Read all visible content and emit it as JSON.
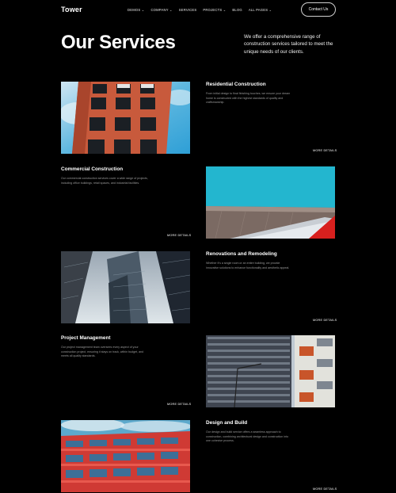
{
  "nav": {
    "logo": "Tower",
    "items": [
      {
        "label": "DEMOS ⌄"
      },
      {
        "label": "COMPANY ⌄"
      },
      {
        "label": "SERVICES"
      },
      {
        "label": "PROJECTS ⌄"
      },
      {
        "label": "BLOG"
      },
      {
        "label": "ALL PAGES ⌄"
      }
    ],
    "contact_label": "Contact Us"
  },
  "hero": {
    "title": "Our Services",
    "description": "We offer a comprehensive range of construction services tailored to meet the unique needs of our clients."
  },
  "services": [
    {
      "title": "Residential Construction",
      "description": "From initial design to final finishing touches, we ensure your dream home is constructed with the highest standards of quality and craftsmanship.",
      "more": "MORE DETAILS"
    },
    {
      "title": "Commercial Construction",
      "description": "Our commercial construction services cover a wide range of projects, including office buildings, retail spaces, and industrial facilities.",
      "more": "MORE DETAILS"
    },
    {
      "title": "Renovations and Remodeling",
      "description": "Whether it's a single room or an entire building, we provide innovative solutions to enhance functionality and aesthetic appeal.",
      "more": "MORE DETAILS"
    },
    {
      "title": "Project Management",
      "description": "Our project management team oversees every aspect of your construction project, ensuring it stays on track, within budget, and meets all quality standards.",
      "more": "MORE DETAILS"
    },
    {
      "title": "Design and Build",
      "description": "Our design and build service offers a seamless approach to construction, combining architectural design and construction into one cohesive process.",
      "more": "MORE DETAILS"
    }
  ]
}
